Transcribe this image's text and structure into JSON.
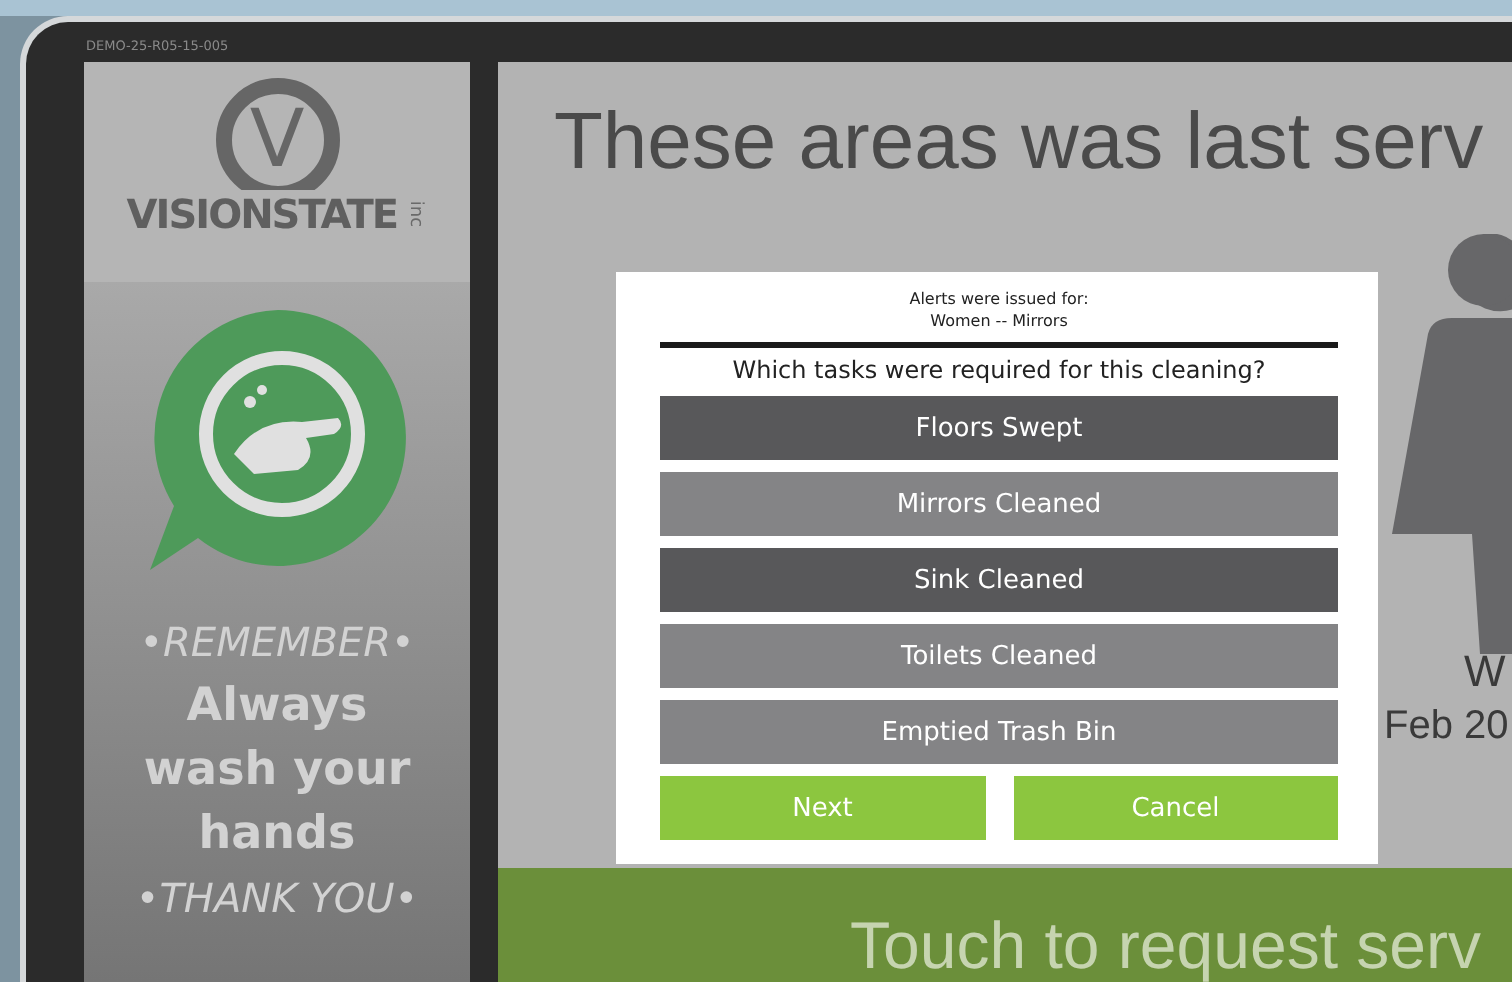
{
  "device_id": "DEMO-25-R05-15-005",
  "logo": {
    "mark": "V",
    "name": "VISIONSTATE",
    "suffix": "inc"
  },
  "poster": {
    "lines": [
      {
        "kind": "caption",
        "text": "•REMEMBER•"
      },
      {
        "kind": "headline",
        "text": "Always"
      },
      {
        "kind": "headline",
        "text": "wash your"
      },
      {
        "kind": "headline",
        "text": "hands"
      },
      {
        "kind": "caption",
        "text": "•THANK YOU•"
      }
    ]
  },
  "main": {
    "title": "These areas was last serv",
    "restroom_label": "W",
    "restroom_date": "Feb 20",
    "touch_bar": "Touch to request serv"
  },
  "dialog": {
    "alert_heading": "Alerts were issued for:",
    "alert_items": "Women -- Mirrors",
    "question": "Which tasks were required for this cleaning?",
    "tasks": [
      {
        "label": "Floors Swept",
        "selected": true
      },
      {
        "label": "Mirrors Cleaned",
        "selected": false
      },
      {
        "label": "Sink Cleaned",
        "selected": true
      },
      {
        "label": "Toilets Cleaned",
        "selected": false
      },
      {
        "label": "Emptied Trash Bin",
        "selected": false
      }
    ],
    "actions": [
      {
        "label": "Next"
      },
      {
        "label": "Cancel"
      }
    ]
  }
}
